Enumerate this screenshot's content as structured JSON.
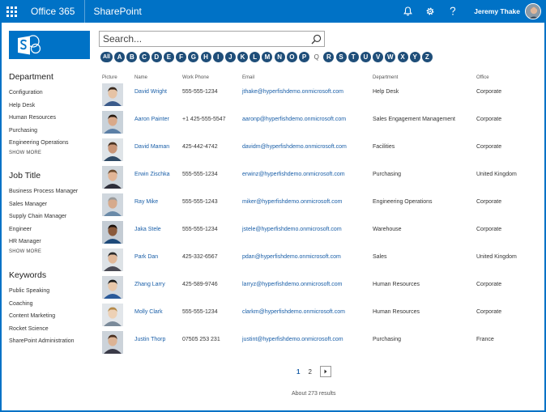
{
  "suite": {
    "brand": "Office 365",
    "app": "SharePoint",
    "user_name": "Jeremy Thake",
    "icons": [
      "app-launcher-icon",
      "bell-icon",
      "gear-icon",
      "help-icon"
    ],
    "bar_color": "#0072c6"
  },
  "search": {
    "placeholder": "Search..."
  },
  "alphabet": {
    "all_label": "All",
    "letters": [
      "A",
      "B",
      "C",
      "D",
      "E",
      "F",
      "G",
      "H",
      "I",
      "J",
      "K",
      "L",
      "M",
      "N",
      "O",
      "P",
      "Q",
      "R",
      "S",
      "T",
      "U",
      "V",
      "W",
      "X",
      "Y",
      "Z"
    ],
    "inactive": [
      "Q"
    ]
  },
  "filters": {
    "department": {
      "heading": "Department",
      "items": [
        "Configuration",
        "Help Desk",
        "Human Resources",
        "Purchasing",
        "Engineering Operations"
      ],
      "more": "SHOW MORE"
    },
    "job_title": {
      "heading": "Job Title",
      "items": [
        "Business Process Manager",
        "Sales Manager",
        "Supply Chain Manager",
        "Engineer",
        "HR Manager"
      ],
      "more": "SHOW MORE"
    },
    "keywords": {
      "heading": "Keywords",
      "items": [
        "Public Speaking",
        "Coaching",
        "Content Marketing",
        "Rocket Science",
        "SharePoint Administration"
      ]
    }
  },
  "table": {
    "headers": {
      "picture": "Picture",
      "name": "Name",
      "phone": "Work Phone",
      "email": "Email",
      "department": "Department",
      "office": "Office"
    },
    "rows": [
      {
        "name": "David Wright",
        "phone": "555-555-1234",
        "email": "jthake@hyperfishdemo.onmicrosoft.com",
        "department": "Help Desk",
        "office": "Corporate"
      },
      {
        "name": "Aaron Painter",
        "phone": "+1 425-555-5547",
        "email": "aaronp@hyperfishdemo.onmicrosoft.com",
        "department": "Sales Engagement Management",
        "office": "Corporate"
      },
      {
        "name": "David Maman",
        "phone": "425-442-4742",
        "email": "davidm@hyperfishdemo.onmicrosoft.com",
        "department": "Facilities",
        "office": "Corporate"
      },
      {
        "name": "Erwin Zischka",
        "phone": "555-555-1234",
        "email": "erwinz@hyperfishdemo.onmicrosoft.com",
        "department": "Purchasing",
        "office": "United Kingdom"
      },
      {
        "name": "Ray Mike",
        "phone": "555-555-1243",
        "email": "miker@hyperfishdemo.onmicrosoft.com",
        "department": "Engineering Operations",
        "office": "Corporate"
      },
      {
        "name": "Jaka Stele",
        "phone": "555-555-1234",
        "email": "jstele@hyperfishdemo.onmicrosoft.com",
        "department": "Warehouse",
        "office": "Corporate"
      },
      {
        "name": "Park Dan",
        "phone": "425-332-6567",
        "email": "pdan@hyperfishdemo.onmicrosoft.com",
        "department": "Sales",
        "office": "United Kingdom"
      },
      {
        "name": "Zhang Larry",
        "phone": "425-589-9746",
        "email": "larryz@hyperfishdemo.onmicrosoft.com",
        "department": "Human Resources",
        "office": "Corporate"
      },
      {
        "name": "Molly Clark",
        "phone": "555-555-1234",
        "email": "clarkm@hyperfishdemo.onmicrosoft.com",
        "department": "Human Resources",
        "office": "Corporate"
      },
      {
        "name": "Justin Thorp",
        "phone": "07505 253 231",
        "email": "justint@hyperfishdemo.onmicrosoft.com",
        "department": "Purchasing",
        "office": "France"
      }
    ]
  },
  "pager": {
    "pages": [
      "1",
      "2"
    ],
    "current": "1"
  },
  "results_text": "About 273 results",
  "colors": {
    "accent": "#0072c6",
    "letter_bg": "#1f4e79",
    "link": "#1a5fa8"
  }
}
